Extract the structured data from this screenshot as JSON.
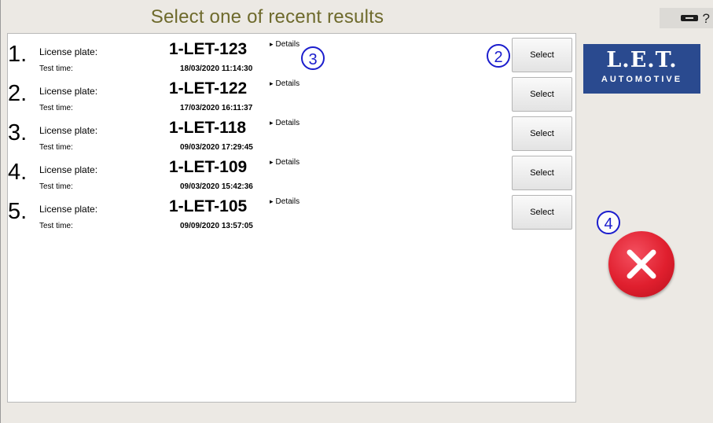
{
  "header": {
    "title": "Select one of recent results",
    "help_symbol": "?"
  },
  "icons": {
    "status": "battery-icon",
    "help": "help-icon",
    "cancel": "close-icon"
  },
  "labels": {
    "license_plate": "License plate:",
    "test_time": "Test time:",
    "details": "Details",
    "select": "Select"
  },
  "results": [
    {
      "index": "1.",
      "plate": "1-LET-123",
      "time": "18/03/2020 11:14:30"
    },
    {
      "index": "2.",
      "plate": "1-LET-122",
      "time": "17/03/2020 16:11:37"
    },
    {
      "index": "3.",
      "plate": "1-LET-118",
      "time": "09/03/2020 17:29:45"
    },
    {
      "index": "4.",
      "plate": "1-LET-109",
      "time": "09/03/2020 15:42:36"
    },
    {
      "index": "5.",
      "plate": "1-LET-105",
      "time": "09/09/2020 13:57:05"
    }
  ],
  "logo": {
    "main": "L.E.T.",
    "sub": "AUTOMOTIVE"
  },
  "callouts": [
    "2",
    "3",
    "4"
  ],
  "colors": {
    "title": "#6e6a2c",
    "logo_bg": "#2a4a8f",
    "cancel": "#e01f2e",
    "callout": "#1b1dcd"
  }
}
